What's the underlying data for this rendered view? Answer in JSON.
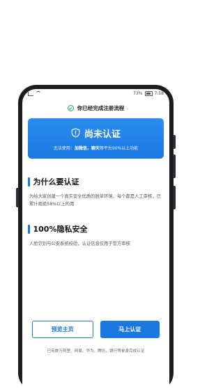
{
  "statusbar": {
    "right_text": "73%",
    "time": "7:58"
  },
  "progress": {
    "text": "你已经完成注册流程"
  },
  "banner": {
    "title": "尚未认证",
    "sub_prefix": "无法使用：",
    "sub_bold": "加微信，聊天",
    "sub_suffix": "等平台90%以上功能"
  },
  "sections": [
    {
      "title": "为什么要认证",
      "text": "为给大家创建一个真实安全优质的脱单环境，每个都是人工审核，已累计拒绝58%以上的用"
    },
    {
      "title": "100%隐私安全",
      "text": "人脸识别与公安系统校验，认证信息仅用于官方审核"
    }
  ],
  "actions": {
    "preview": "预览主页",
    "verify": "马上认证"
  },
  "footer": {
    "note": "已有数万阿里、网易、华为、腾讯、银行等单身完成认证"
  },
  "icons": {
    "check": "check-circle-icon",
    "shield": "shield-alert-icon"
  },
  "colors": {
    "accent": "#1a78e0",
    "success": "#23a55a"
  }
}
